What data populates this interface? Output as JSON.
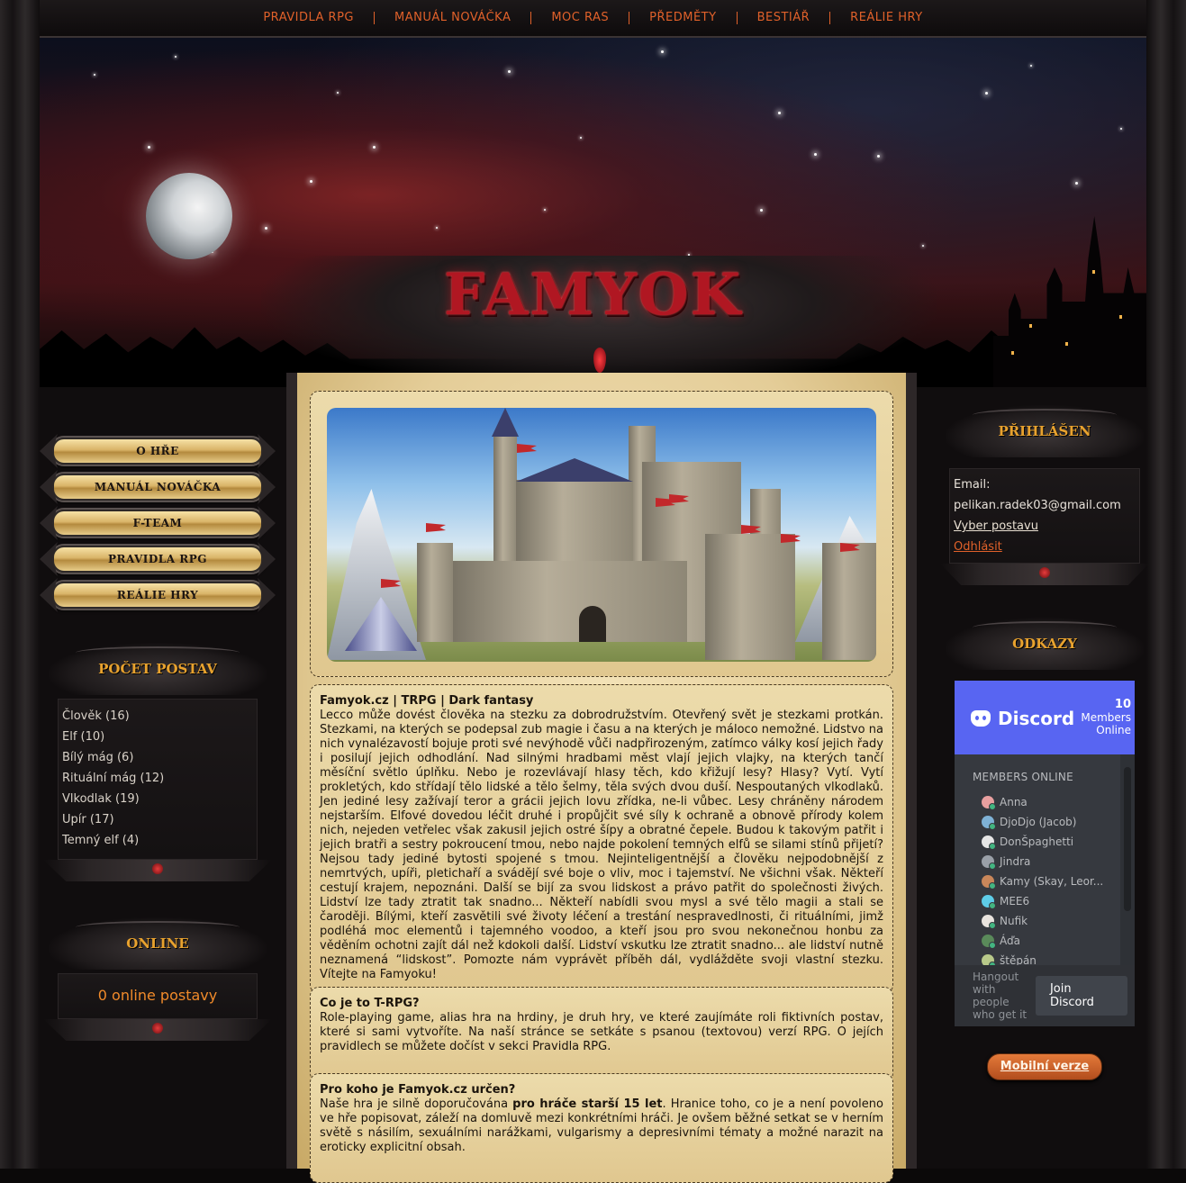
{
  "nav": {
    "items": [
      "PRAVIDLA RPG",
      "MANUÁL NOVÁČKA",
      "MOC RAS",
      "PŘEDMĚTY",
      "BESTIÁŘ",
      "REÁLIE HRY"
    ]
  },
  "header": {
    "logo_text": "FAMYOK"
  },
  "left_menu": {
    "buttons": [
      "O HŘE",
      "MANUÁL NOVÁČKA",
      "F-TEAM",
      "PRAVIDLA RPG",
      "REÁLIE HRY"
    ]
  },
  "character_count": {
    "title": "POČET POSTAV",
    "races": [
      "Člověk (16)",
      "Elf (10)",
      "Bílý mág (6)",
      "Rituální mág (12)",
      "Vlkodlak (19)",
      "Upír (17)",
      "Temný elf (4)"
    ]
  },
  "online": {
    "title": "ONLINE",
    "count_text": "0 online postavy"
  },
  "login": {
    "title": "PŘIHLÁŠEN",
    "email_label": "Email:",
    "email": "pelikan.radek03@gmail.com",
    "choose_character": "Vyber postavu",
    "logout": "Odhlásit"
  },
  "links": {
    "title": "ODKAZY",
    "discord": {
      "brand": "Discord",
      "members_count": "10",
      "members_label": "Members",
      "online_label": "Online",
      "members_header": "MEMBERS ONLINE",
      "members": [
        "Anna",
        "DjoDjo (Jacob)",
        "DonŠpaghetti",
        "Jindra",
        "Kamy (Skay, Leor...",
        "MEE6",
        "Nufik",
        "Áďa",
        "štěpán"
      ],
      "hangout": "Hangout with people who get it",
      "join_label": "Join Discord"
    },
    "mobile_button": "Mobilní verze"
  },
  "content": {
    "intro": {
      "title": "Famyok.cz | TRPG | Dark fantasy",
      "text": "Lecco může dovést člověka na stezku za dobrodružstvím. Otevřený svět je stezkami protkán. Stezkami, na kterých se podepsal zub magie i času a na kterých je máloco nemožné. Lidstvo na nich vynalézavostí bojuje proti své nevýhodě vůči nadpřirozeným, zatímco války kosí jejich řady i posilují jejich odhodlání. Nad silnými hradbami měst vlají jejich vlajky, na kterých tančí měsíční světlo úplňku. Nebo je rozevlávají hlasy těch, kdo křižují lesy? Hlasy? Vytí. Vytí prokletých, kdo střídají tělo lidské a tělo šelmy, těla svých dvou duší. Nespoutaných vlkodlaků. Jen jediné lesy zažívají teror a grácii jejich lovu zřídka, ne-li vůbec. Lesy chráněny národem nejstarším. Elfové dovedou léčit druhé i propůjčit své síly k ochraně a obnově přírody kolem nich, nejeden vetřelec však zakusil jejich ostré šípy a obratné čepele. Budou k takovým patřit i jejich bratři a sestry pokroucení tmou, nebo najde pokolení temných elfů se silami stínů přijetí? Nejsou tady jediné bytosti spojené s tmou. Nejinteligentnější a člověku nejpodobnější z nemrtvých, upíři, pletichaří a svádějí své boje o vliv, moc i tajemství. Ne všichni však. Někteří cestují krajem, nepoznáni. Další se bijí za svou lidskost a právo patřit do společnosti živých. Lidství lze tady ztratit tak snadno... Někteří nabídli svou mysl a své tělo magii a stali se čaroději. Bílými, kteří zasvětili své životy léčení a trestání nespravedlnosti, či rituálními, jimž podléhá moc elementů i tajemného voodoo, a kteří jsou pro svou nekonečnou honbu za věděním ochotni zajít dál než kdokoli další. Lidství vskutku lze ztratit snadno... ale lidství nutně neznamená “lidskost”. Pomozte nám vyprávět příběh dál, vydlážděte svoji vlastní stezku. Vítejte na Famyoku!"
    },
    "trpg": {
      "title": "Co je to T-RPG?",
      "text": "Role-playing game, alias hra na hrdiny, je druh hry, ve které zaujímáte roli fiktivních postav, které si sami vytvoříte. Na naší stránce se setkáte s psanou (textovou) verzí RPG. O jejích pravidlech se můžete dočíst v sekci Pravidla RPG."
    },
    "audience": {
      "title": "Pro koho je Famyok.cz určen?",
      "text_before": "Naše hra je silně doporučována ",
      "text_bold": "pro hráče starší 15 let",
      "text_after": ". Hranice toho, co je a není povoleno ve hře popisovat, záleží na domluvě mezi konkrétními hráči. Je ovšem běžné setkat se v herním světě s násilím, sexuálními narážkami, vulgarismy a depresivními tématy a možné narazit na eroticky explicitní obsah."
    }
  },
  "colors": {
    "accent": "#e0612a",
    "gold": "#e8a22e",
    "logo_red": "#b01722",
    "discord": "#5865f2"
  }
}
